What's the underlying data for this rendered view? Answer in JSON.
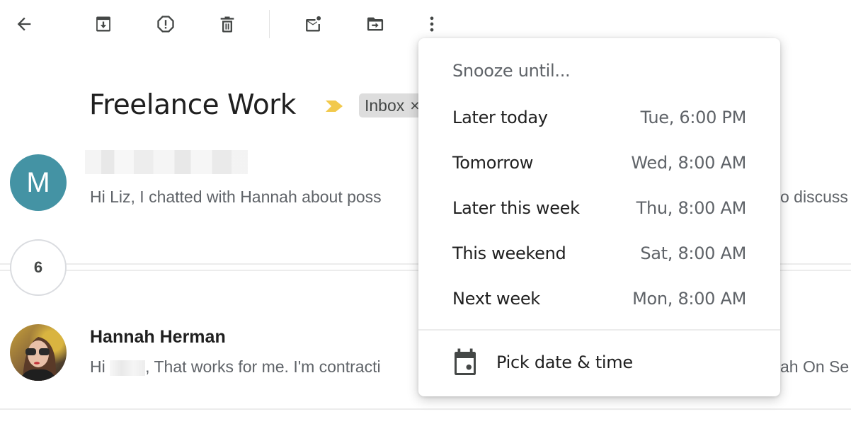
{
  "toolbar": {
    "back": "back-icon",
    "archive": "archive-icon",
    "spam": "report-spam-icon",
    "delete": "delete-icon",
    "mark_unread": "mark-unread-icon",
    "move": "move-to-icon",
    "more": "more-vert-icon"
  },
  "thread": {
    "subject": "Freelance Work",
    "label_chip": "Inbox",
    "label_chip_close": "×",
    "importance_color": "#f2c94c",
    "collapsed_count": "6",
    "messages": [
      {
        "avatar_letter": "M",
        "avatar_color": "#4493a4",
        "snippet": "Hi Liz, I chatted with Hannah about poss",
        "snippet_tail": "o discuss"
      },
      {
        "sender": "Hannah Herman",
        "snippet_prefix": "Hi",
        "snippet": ", That works for me. I'm contracti",
        "snippet_tail": "ah On Se"
      }
    ]
  },
  "snooze_menu": {
    "title": "Snooze until...",
    "items": [
      {
        "label": "Later today",
        "time": "Tue, 6:00 PM"
      },
      {
        "label": "Tomorrow",
        "time": "Wed, 8:00 AM"
      },
      {
        "label": "Later this week",
        "time": "Thu, 8:00 AM"
      },
      {
        "label": "This weekend",
        "time": "Sat, 8:00 AM"
      },
      {
        "label": "Next week",
        "time": "Mon, 8:00 AM"
      }
    ],
    "pick_label": "Pick date & time"
  }
}
